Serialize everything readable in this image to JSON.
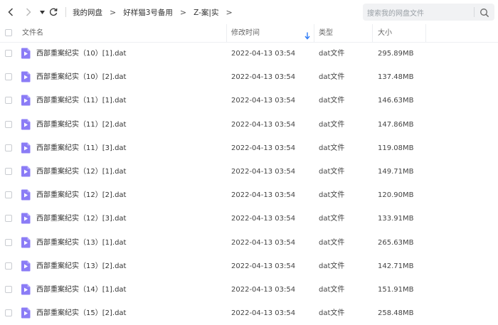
{
  "nav": {
    "back_icon": "chevron-left-icon",
    "forward_icon": "chevron-right-icon",
    "dropdown_icon": "caret-down-icon",
    "refresh_icon": "refresh-icon"
  },
  "breadcrumb": [
    "我的网盘",
    "好样猫3号备用",
    "Z-案|实"
  ],
  "breadcrumb_separator": ">",
  "search": {
    "placeholder": "搜索我的网盘文件",
    "icon": "search-icon"
  },
  "columns": {
    "name": "文件名",
    "modified": "修改时间",
    "type": "类型",
    "size": "大小",
    "sort_icon": "arrow-down-icon"
  },
  "files": [
    {
      "name": "西部重案纪实（10）[1].dat",
      "modified": "2022-04-13 03:54",
      "type": "dat文件",
      "size": "295.89MB"
    },
    {
      "name": "西部重案纪实（10）[2].dat",
      "modified": "2022-04-13 03:54",
      "type": "dat文件",
      "size": "137.48MB"
    },
    {
      "name": "西部重案纪实（11）[1].dat",
      "modified": "2022-04-13 03:54",
      "type": "dat文件",
      "size": "146.63MB"
    },
    {
      "name": "西部重案纪实（11）[2].dat",
      "modified": "2022-04-13 03:54",
      "type": "dat文件",
      "size": "147.86MB"
    },
    {
      "name": "西部重案纪实（11）[3].dat",
      "modified": "2022-04-13 03:54",
      "type": "dat文件",
      "size": "119.08MB"
    },
    {
      "name": "西部重案纪实（12）[1].dat",
      "modified": "2022-04-13 03:54",
      "type": "dat文件",
      "size": "149.71MB"
    },
    {
      "name": "西部重案纪实（12）[2].dat",
      "modified": "2022-04-13 03:54",
      "type": "dat文件",
      "size": "120.90MB"
    },
    {
      "name": "西部重案纪实（12）[3].dat",
      "modified": "2022-04-13 03:54",
      "type": "dat文件",
      "size": "133.91MB"
    },
    {
      "name": "西部重案纪实（13）[1].dat",
      "modified": "2022-04-13 03:54",
      "type": "dat文件",
      "size": "265.63MB"
    },
    {
      "name": "西部重案纪实（13）[2].dat",
      "modified": "2022-04-13 03:54",
      "type": "dat文件",
      "size": "142.71MB"
    },
    {
      "name": "西部重案纪实（14）[1].dat",
      "modified": "2022-04-13 03:54",
      "type": "dat文件",
      "size": "151.91MB"
    },
    {
      "name": "西部重案纪实（15）[2].dat",
      "modified": "2022-04-13 03:54",
      "type": "dat文件",
      "size": "258.48MB"
    }
  ],
  "file_icon": "video-file-icon",
  "colors": {
    "file_icon": "#8b7cf6",
    "sort_arrow": "#2f7cf6"
  }
}
